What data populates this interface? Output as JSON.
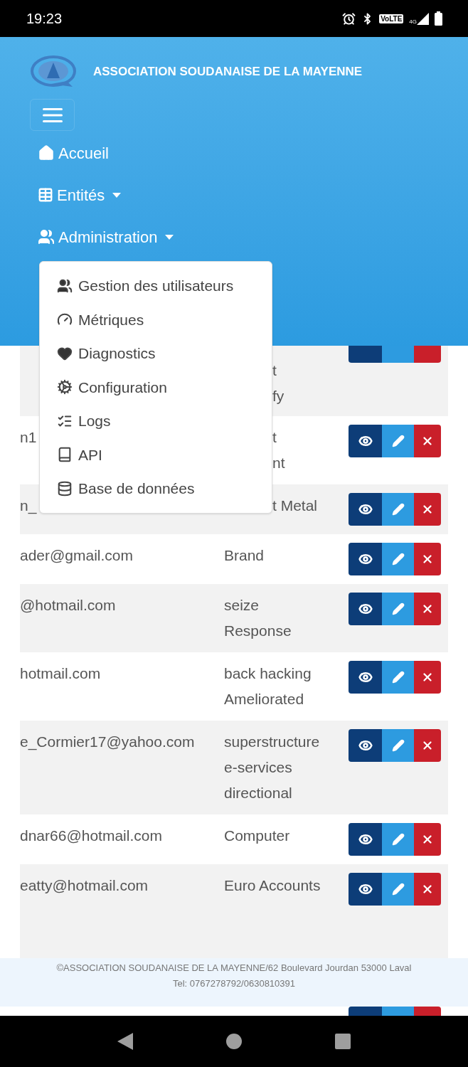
{
  "status_bar": {
    "time": "19:23",
    "volte": "VoLTE",
    "network": "4G"
  },
  "header": {
    "title": "ASSOCIATION SOUDANAISE DE LA MAYENNE",
    "nav": [
      {
        "label": "Accueil",
        "kind": "home",
        "dropdown": false
      },
      {
        "label": "Entités",
        "kind": "table",
        "dropdown": true
      },
      {
        "label": "Administration",
        "kind": "users",
        "dropdown": true
      }
    ]
  },
  "admin_menu": [
    {
      "label": "Gestion des utilisateurs",
      "kind": "users"
    },
    {
      "label": "Métriques",
      "kind": "gauge"
    },
    {
      "label": "Diagnostics",
      "kind": "heart"
    },
    {
      "label": "Configuration",
      "kind": "cogs"
    },
    {
      "label": "Logs",
      "kind": "tasks"
    },
    {
      "label": "API",
      "kind": "book"
    },
    {
      "label": "Base de données",
      "kind": "database"
    }
  ],
  "table": {
    "rows": [
      {
        "category": [
          "t",
          "fy"
        ],
        "covered": true,
        "kind": "bottom"
      },
      {
        "email": "n1",
        "category": [
          "t",
          "nt"
        ],
        "covered": true,
        "kind": "full"
      },
      {
        "email": "n_",
        "category": [
          "t Metal"
        ],
        "covered": true,
        "kind": "full"
      },
      {
        "email": "ader@gmail.com",
        "category": [
          "Brand"
        ],
        "covered": false,
        "kind": "full"
      },
      {
        "email": "@hotmail.com",
        "category": [
          "seize",
          "Response"
        ],
        "covered": false,
        "kind": "full"
      },
      {
        "email": "hotmail.com",
        "category": [
          "back hacking",
          "Ameliorated"
        ],
        "covered": false,
        "kind": "full"
      },
      {
        "email": "e_Cormier17@yahoo.com",
        "category": [
          "superstructure",
          "e-services",
          "directional"
        ],
        "covered": false,
        "kind": "full"
      },
      {
        "email": "dnar66@hotmail.com",
        "category": [
          "Computer"
        ],
        "covered": false,
        "kind": "full"
      },
      {
        "email": "eatty@hotmail.com",
        "category": [
          "Euro Accounts"
        ],
        "covered": false,
        "kind": "full"
      },
      {
        "kind": "top"
      }
    ]
  },
  "footer": {
    "lines": [
      "©ASSOCIATION SOUDANAISE DE LA MAYENNE/62 Boulevard Jourdan 53000 Laval",
      "Tel: 0767278792/0630810391"
    ]
  }
}
